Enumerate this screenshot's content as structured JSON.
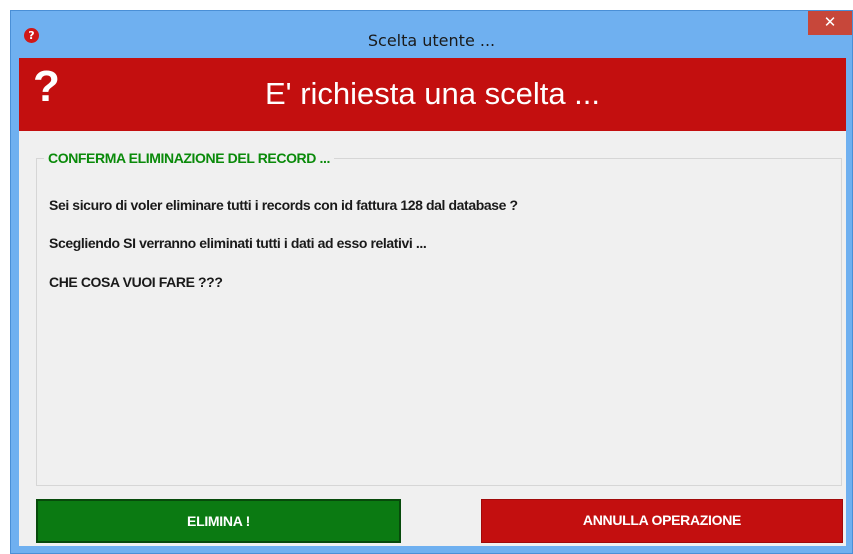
{
  "window": {
    "title": "Scelta utente ...",
    "title_icon_glyph": "?",
    "close_glyph": "✕"
  },
  "banner": {
    "icon_glyph": "?",
    "heading": "E' richiesta una scelta ..."
  },
  "group": {
    "legend": "CONFERMA ELIMINAZIONE DEL RECORD ...",
    "lines": [
      "Sei sicuro di voler eliminare tutti i records con id fattura 128 dal database ?",
      "Scegliendo SI verranno eliminati tutti i dati ad esso relativi ...",
      "CHE COSA VUOI FARE ???"
    ]
  },
  "buttons": {
    "delete_label": "ELIMINA !",
    "cancel_label": "ANNULLA OPERAZIONE"
  },
  "colors": {
    "titlebar": "#6fb0f0",
    "banner_red": "#c30f0f",
    "delete_green": "#0b7a12",
    "legend_green": "#0a8a0a",
    "close_red": "#c7473a"
  }
}
